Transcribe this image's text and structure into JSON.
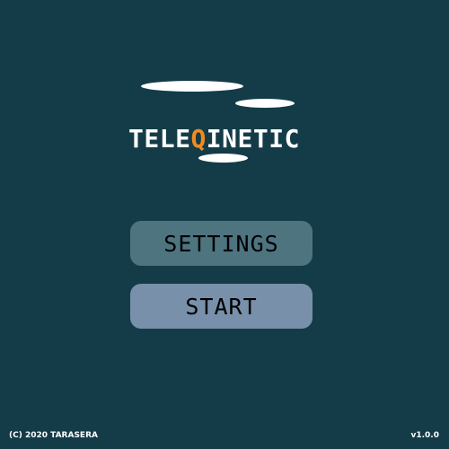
{
  "title": {
    "prefix": "TELE",
    "accent_letter": "Q",
    "suffix": "INETIC"
  },
  "menu": {
    "settings_label": "SETTINGS",
    "start_label": "START"
  },
  "footer": {
    "copyright": "(C) 2020 TARASERA",
    "version": "v1.0.0"
  },
  "colors": {
    "background": "#143c48",
    "accent": "#f28a1c",
    "settings_button": "#4e7480",
    "start_button": "#7890aa"
  }
}
